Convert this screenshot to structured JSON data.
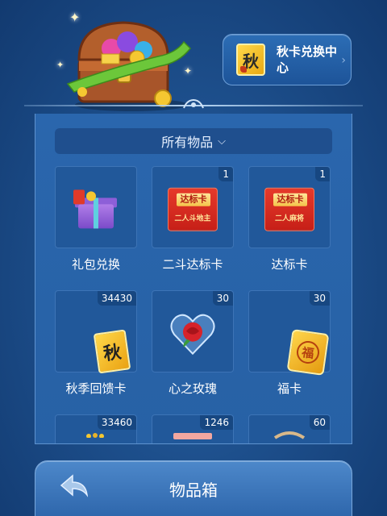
{
  "header": {
    "exchange_center_label": "秋卡兑换中心",
    "exchange_card_glyph": "秋"
  },
  "filter": {
    "selected": "所有物品"
  },
  "items": [
    {
      "name": "礼包兑换",
      "count": "",
      "icon": "gift-box-icon"
    },
    {
      "name": "二斗达标卡",
      "count": "1",
      "icon": "red-envelope-icon",
      "tag": "达标卡",
      "sub": "二人斗地主"
    },
    {
      "name": "达标卡",
      "count": "1",
      "icon": "red-envelope-icon",
      "tag": "达标卡",
      "sub": "二人麻将"
    },
    {
      "name": "秋季回馈卡",
      "count": "34430",
      "icon": "autumn-card-icon",
      "glyph": "秋"
    },
    {
      "name": "心之玫瑰",
      "count": "30",
      "icon": "rose-heart-icon"
    },
    {
      "name": "福卡",
      "count": "30",
      "icon": "fortune-card-icon",
      "glyph": "福"
    },
    {
      "name": "",
      "count": "33460",
      "icon": "partial-item-icon"
    },
    {
      "name": "",
      "count": "1246",
      "icon": "partial-item-icon"
    },
    {
      "name": "",
      "count": "60",
      "icon": "partial-item-icon"
    }
  ],
  "bottom_bar": {
    "title": "物品箱"
  },
  "colors": {
    "background": "#1d4f8c",
    "panel": "#2a66ad",
    "slot": "#21589a",
    "accent_gold": "#f5c731",
    "envelope_red": "#e63a2b"
  }
}
